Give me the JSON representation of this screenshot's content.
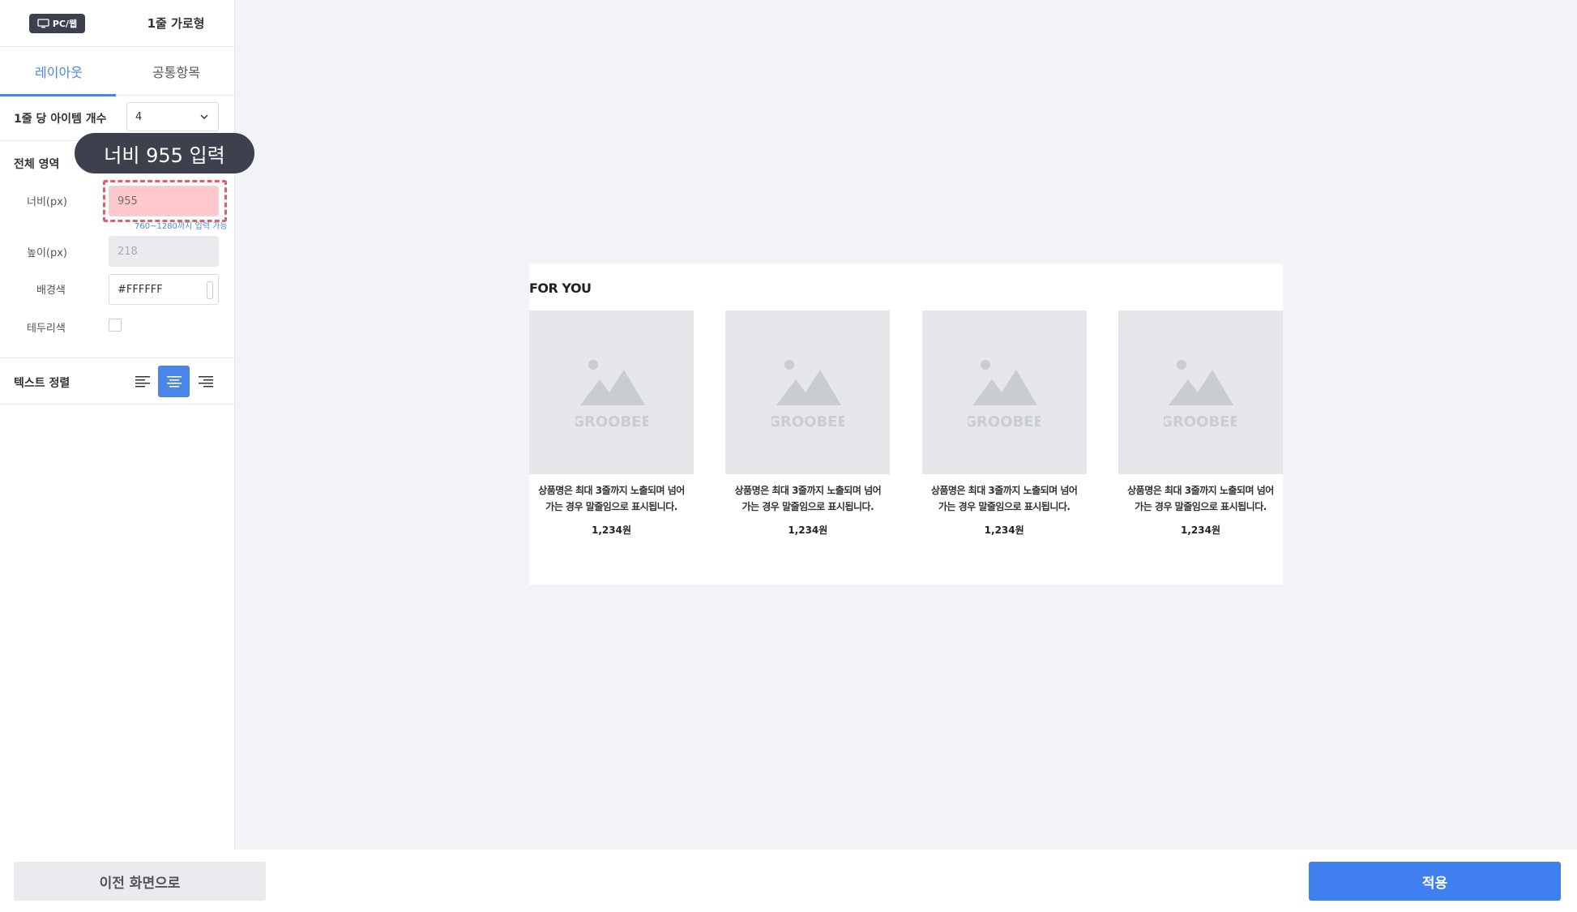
{
  "sidebar": {
    "device_badge": "PC/웹",
    "layout_type": "1줄 가로형",
    "tabs": [
      {
        "label": "레이아웃",
        "active": true
      },
      {
        "label": "공통항목",
        "active": false
      }
    ],
    "items_per_row": {
      "label": "1줄 당 아이템 개수",
      "value": "4"
    },
    "area": {
      "title": "전체 영역",
      "width_label": "너비(px)",
      "width_value": "955",
      "width_hint": "760~1280까지 입력 가능",
      "height_label": "높이(px)",
      "height_value": "218",
      "bg_label": "배경색",
      "bg_value": "#FFFFFF",
      "border_label": "테두리색"
    },
    "text_align": {
      "label": "텍스트 정렬",
      "selected": "center"
    }
  },
  "tooltip": "너비 955 입력",
  "preview": {
    "title": "FOR YOU",
    "placeholder_brand": "GROOBEE",
    "cards": [
      {
        "name_line1": "상품명은 최대 3줄까지 노출되며 넘어",
        "name_line2": "가는 경우 말줄임으로 표시됩니다.",
        "price": "1,234원"
      },
      {
        "name_line1": "상품명은 최대 3줄까지 노출되며 넘어",
        "name_line2": "가는 경우 말줄임으로 표시됩니다.",
        "price": "1,234원"
      },
      {
        "name_line1": "상품명은 최대 3줄까지 노출되며 넘어",
        "name_line2": "가는 경우 말줄임으로 표시됩니다.",
        "price": "1,234원"
      },
      {
        "name_line1": "상품명은 최대 3줄까지 노출되며 넘어",
        "name_line2": "가는 경우 말줄임으로 표시됩니다.",
        "price": "1,234원"
      }
    ]
  },
  "footer": {
    "prev_label": "이전 화면으로",
    "apply_label": "적용"
  },
  "colors": {
    "accent": "#4a86e8",
    "apply_button": "#3f7ff0",
    "highlight": "#ffc9cc",
    "highlight_border": "#e65c66",
    "dark": "#3d414d"
  }
}
